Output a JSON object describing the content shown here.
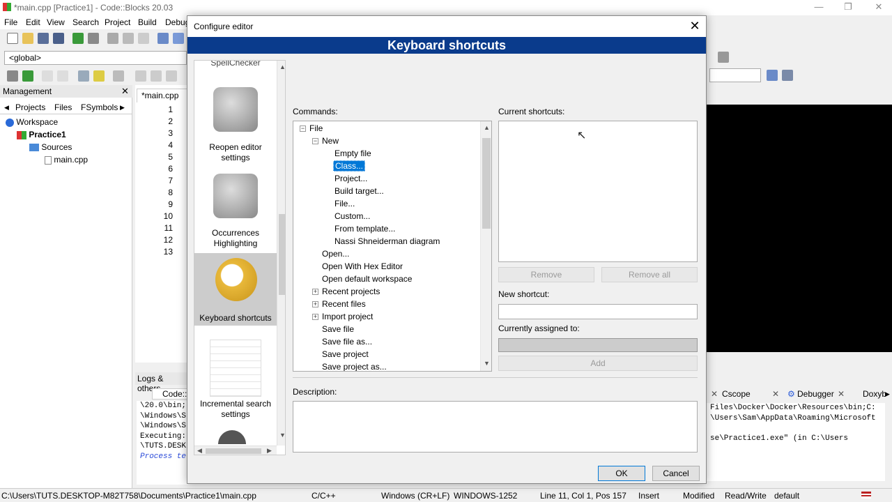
{
  "window": {
    "title": "*main.cpp [Practice1] - Code::Blocks 20.03",
    "minimize": "—",
    "maximize": "❐",
    "close": "✕"
  },
  "menu": [
    "File",
    "Edit",
    "View",
    "Search",
    "Project",
    "Build",
    "Debug"
  ],
  "global_scope": "<global>",
  "management": {
    "title": "Management",
    "tabs": [
      "Projects",
      "Files",
      "FSymbols"
    ],
    "tree": [
      "Workspace",
      "Practice1",
      "Sources",
      "main.cpp"
    ]
  },
  "editor": {
    "tab": "*main.cpp",
    "line_numbers": [
      "1",
      "2",
      "3",
      "4",
      "5",
      "6",
      "7",
      "8",
      "9",
      "10",
      "11",
      "12",
      "13"
    ]
  },
  "logs": {
    "title": "Logs & others",
    "tab_left": "Code::B",
    "lines": [
      "\\20.0\\bin;",
      "\\Windows\\S",
      "\\Windows\\S",
      "Executing:",
      "\\TUTS.DESK",
      "Process te"
    ],
    "tabs_right": [
      "Cscope",
      "Debugger",
      "Doxyb"
    ],
    "right_lines": [
      "Files\\Docker\\Docker\\Resources\\bin;C:",
      "\\Users\\Sam\\AppData\\Roaming\\Microsoft",
      "",
      "se\\Practice1.exe\"  (in C:\\Users"
    ]
  },
  "statusbar": {
    "path": "C:\\Users\\TUTS.DESKTOP-M82T758\\Documents\\Practice1\\main.cpp",
    "lang": "C/C++",
    "eol": "Windows (CR+LF)",
    "encoding": "WINDOWS-1252",
    "position": "Line 11, Col 1, Pos 157",
    "mode": "Insert",
    "modified": "Modified",
    "access": "Read/Write",
    "profile": "default"
  },
  "dialog": {
    "title": "Configure editor",
    "banner": "Keyboard shortcuts",
    "categories": [
      {
        "label": "SpellChecker"
      },
      {
        "label": "Reopen editor settings"
      },
      {
        "label": "Occurrences Highlighting"
      },
      {
        "label": "Keyboard shortcuts"
      },
      {
        "label": "Incremental search settings"
      }
    ],
    "commands_label": "Commands:",
    "current_shortcuts_label": "Current shortcuts:",
    "new_shortcut_label": "New shortcut:",
    "assigned_label": "Currently assigned to:",
    "description_label": "Description:",
    "buttons": {
      "remove": "Remove",
      "remove_all": "Remove all",
      "add": "Add",
      "ok": "OK",
      "cancel": "Cancel"
    },
    "tree": {
      "root": "File",
      "new": "New",
      "new_children": [
        "Empty file",
        "Class...",
        "Project...",
        "Build target...",
        "File...",
        "Custom...",
        "From template...",
        "Nassi Shneiderman diagram"
      ],
      "file_children": [
        "Open...",
        "Open With Hex Editor",
        "Open default workspace",
        "Recent projects",
        "Recent files",
        "Import project",
        "Save file",
        "Save file as...",
        "Save project",
        "Save project as..."
      ]
    }
  }
}
